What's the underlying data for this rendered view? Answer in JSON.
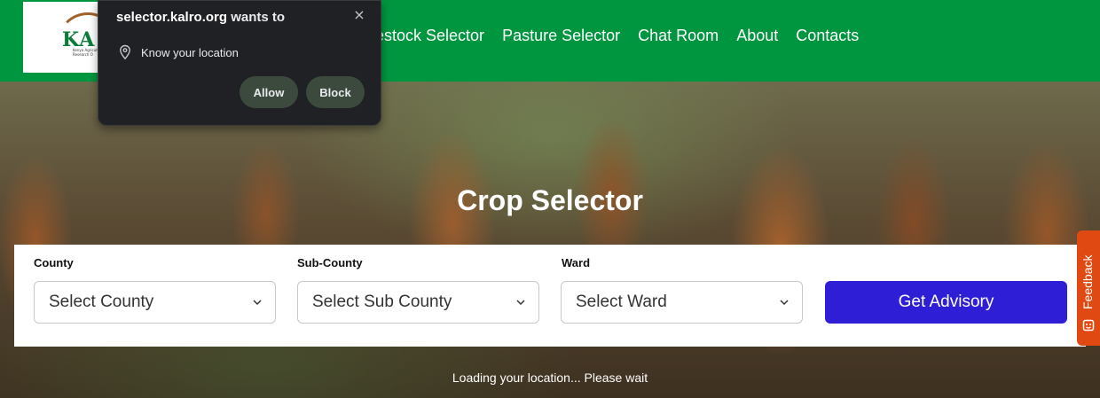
{
  "colors": {
    "navbar": "#00963f",
    "primary_button": "#2e1fd6",
    "feedback_tab": "#e04a12",
    "popup_bg": "#202124"
  },
  "logo": {
    "letters": "KA",
    "tagline": "Kenya Agricultural Research O"
  },
  "nav": {
    "items": [
      {
        "label": "vestock Selector"
      },
      {
        "label": "Pasture Selector"
      },
      {
        "label": "Chat Room"
      },
      {
        "label": "About"
      },
      {
        "label": "Contacts"
      }
    ]
  },
  "popup": {
    "site": "selector.kalro.org",
    "wants": "wants to",
    "permission": "Know your location",
    "allow_label": "Allow",
    "block_label": "Block",
    "close_icon": "×"
  },
  "hero": {
    "title": "Crop Selector",
    "status": "Loading your location... Please wait"
  },
  "form": {
    "county": {
      "label": "County",
      "value": "Select County"
    },
    "subcounty": {
      "label": "Sub-County",
      "value": "Select Sub County"
    },
    "ward": {
      "label": "Ward",
      "value": "Select Ward"
    },
    "submit_label": "Get Advisory"
  },
  "feedback": {
    "label": "Feedback"
  }
}
